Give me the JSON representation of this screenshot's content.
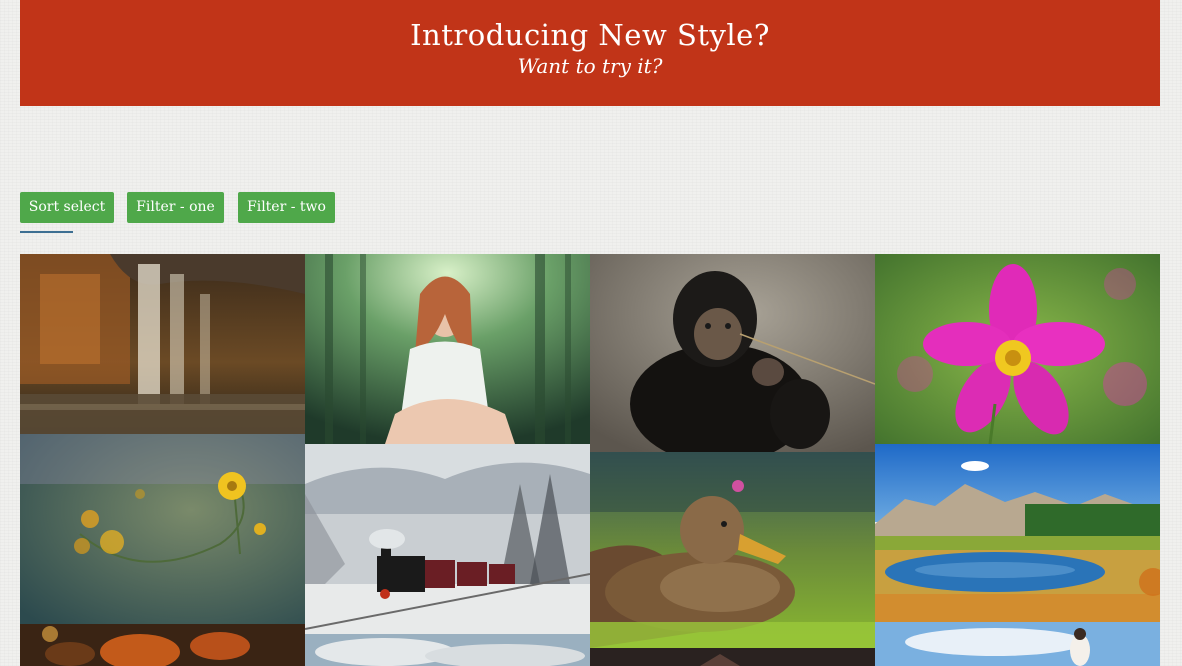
{
  "banner": {
    "title": "Introducing New Style?",
    "subtitle": "Want to try it?",
    "color": "#c13418"
  },
  "filters": {
    "items": [
      {
        "label": "Sort select",
        "active": true
      },
      {
        "label": "Filter - one",
        "active": false
      },
      {
        "label": "Filter - two",
        "active": false
      }
    ],
    "color": "#4fa84a",
    "active_underline_color": "#3d6f92"
  },
  "gallery": {
    "items": [
      {
        "subject": "waterfall"
      },
      {
        "subject": "woman-in-forest"
      },
      {
        "subject": "chimpanzee"
      },
      {
        "subject": "pink-cosmos-flower"
      },
      {
        "subject": "yellow-wildflowers"
      },
      {
        "subject": "steam-train-in-snow"
      },
      {
        "subject": "duck-in-grass"
      },
      {
        "subject": "mountain-lake"
      },
      {
        "subject": "autumn-leaves"
      },
      {
        "subject": "cloudy-sky"
      },
      {
        "subject": "dusk-landscape"
      },
      {
        "subject": "person-against-sky"
      }
    ]
  }
}
